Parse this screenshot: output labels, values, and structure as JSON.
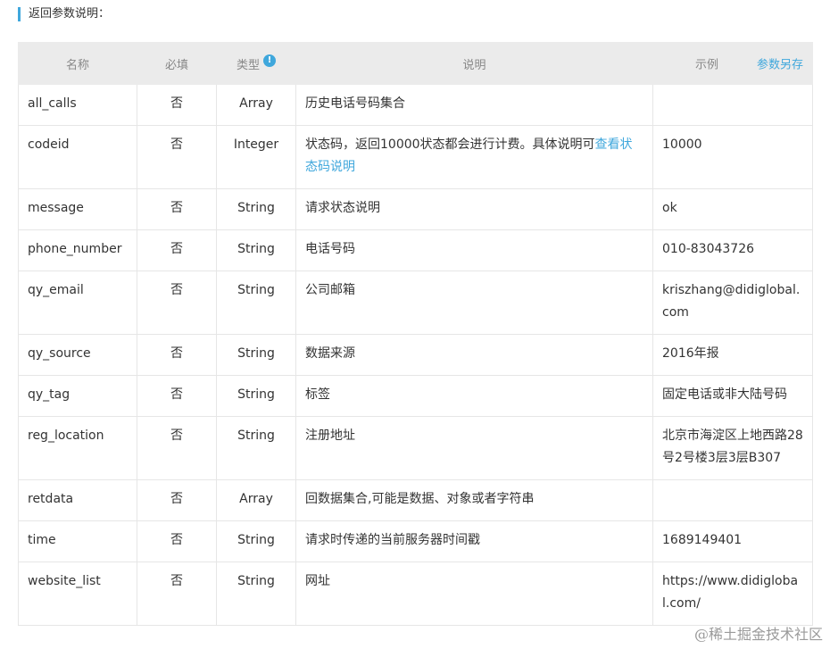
{
  "section_title": "返回参数说明：",
  "header": {
    "name": "名称",
    "required": "必填",
    "type": "类型",
    "type_info_icon": "info-icon",
    "description": "说明",
    "example": "示例",
    "save_link": "参数另存"
  },
  "rows": [
    {
      "name": "all_calls",
      "required": "否",
      "type": "Array",
      "desc": "历史电话号码集合",
      "desc_link": "",
      "example": ""
    },
    {
      "name": "codeid",
      "required": "否",
      "type": "Integer",
      "desc": "状态码，返回10000状态都会进行计费。具体说明可",
      "desc_link": "查看状态码说明",
      "example": "10000"
    },
    {
      "name": "message",
      "required": "否",
      "type": "String",
      "desc": "请求状态说明",
      "desc_link": "",
      "example": "ok"
    },
    {
      "name": "phone_number",
      "required": "否",
      "type": "String",
      "desc": "电话号码",
      "desc_link": "",
      "example": "010-83043726"
    },
    {
      "name": "qy_email",
      "required": "否",
      "type": "String",
      "desc": "公司邮箱",
      "desc_link": "",
      "example": "kriszhang@didiglobal.com"
    },
    {
      "name": "qy_source",
      "required": "否",
      "type": "String",
      "desc": "数据来源",
      "desc_link": "",
      "example": "2016年报"
    },
    {
      "name": "qy_tag",
      "required": "否",
      "type": "String",
      "desc": "标签",
      "desc_link": "",
      "example": "固定电话或非大陆号码"
    },
    {
      "name": "reg_location",
      "required": "否",
      "type": "String",
      "desc": "注册地址",
      "desc_link": "",
      "example": "北京市海淀区上地西路28号2号楼3层3层B307"
    },
    {
      "name": "retdata",
      "required": "否",
      "type": "Array",
      "desc": "回数据集合,可能是数据、对象或者字符串",
      "desc_link": "",
      "example": ""
    },
    {
      "name": "time",
      "required": "否",
      "type": "String",
      "desc": "请求时传递的当前服务器时间戳",
      "desc_link": "",
      "example": "1689149401"
    },
    {
      "name": "website_list",
      "required": "否",
      "type": "String",
      "desc": "网址",
      "desc_link": "",
      "example": "https://www.didiglobal.com/"
    }
  ],
  "watermark": "@稀土掘金技术社区",
  "colors": {
    "accent": "#3fa7dc",
    "header_bg": "#ebebeb",
    "border": "#e6e6e6"
  }
}
